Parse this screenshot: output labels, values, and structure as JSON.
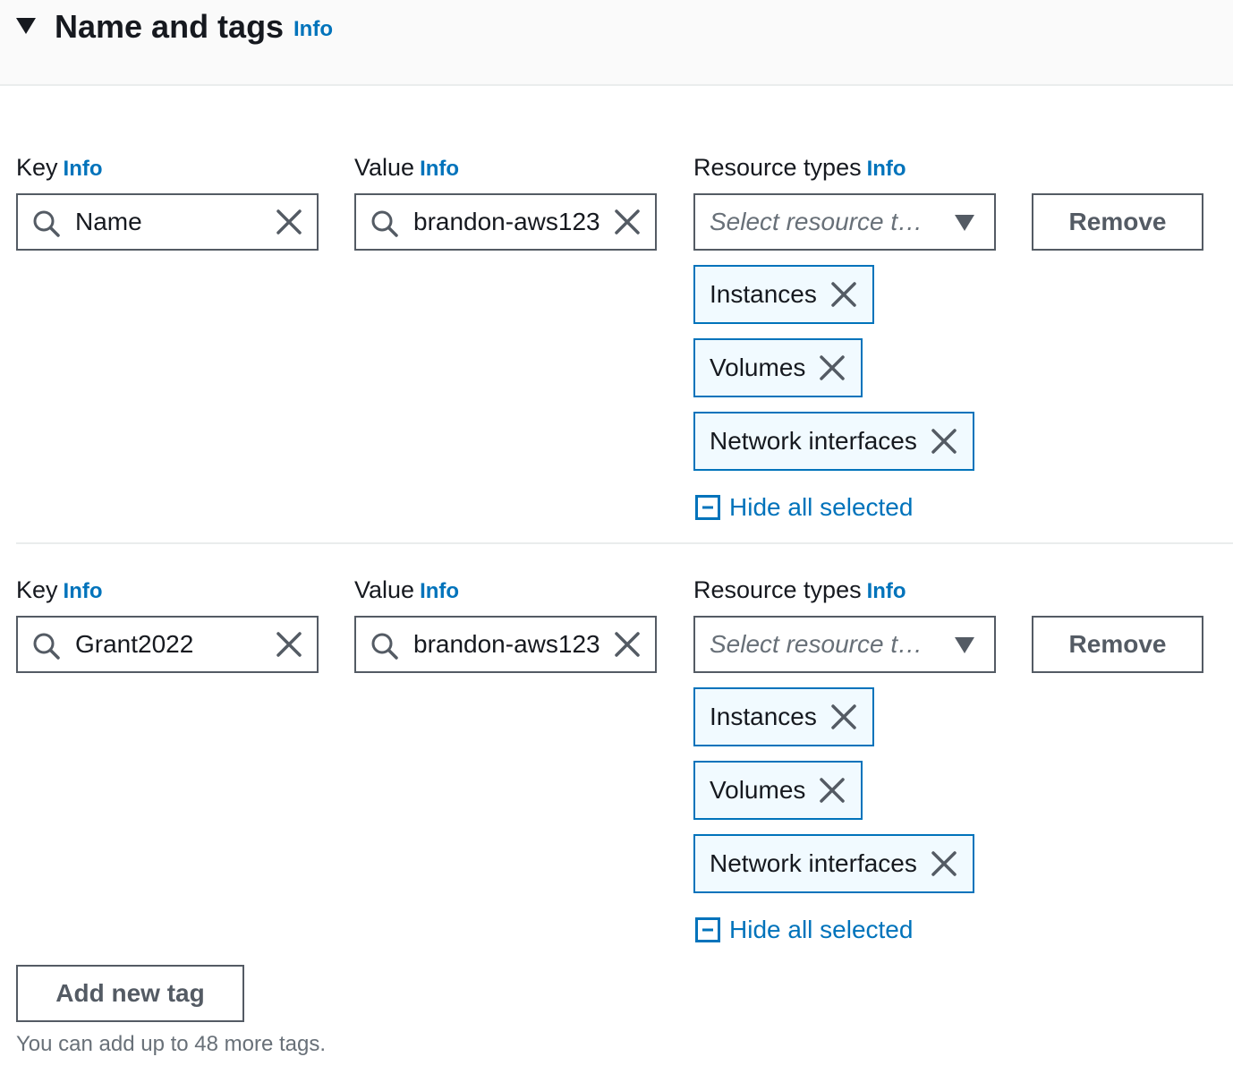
{
  "section": {
    "title": "Name and tags",
    "info_label": "Info"
  },
  "tags": [
    {
      "key_label": "Key",
      "key_info": "Info",
      "value_label": "Value",
      "value_info": "Info",
      "resource_label": "Resource types",
      "resource_info": "Info",
      "key_value": "Name",
      "value_value": "brandon-aws123",
      "resource_placeholder": "Select resource types",
      "remove_label": "Remove",
      "selected_resources": [
        "Instances",
        "Volumes",
        "Network interfaces"
      ],
      "hide_label": "Hide all selected"
    },
    {
      "key_label": "Key",
      "key_info": "Info",
      "value_label": "Value",
      "value_info": "Info",
      "resource_label": "Resource types",
      "resource_info": "Info",
      "key_value": "Grant2022",
      "value_value": "brandon-aws123",
      "resource_placeholder": "Select resource types",
      "remove_label": "Remove",
      "selected_resources": [
        "Instances",
        "Volumes",
        "Network interfaces"
      ],
      "hide_label": "Hide all selected"
    }
  ],
  "add_tag_label": "Add new tag",
  "tags_remaining_hint": "You can add up to 48 more tags.",
  "colors": {
    "link": "#0073bb",
    "border": "#545b64",
    "token_bg": "#f1faff",
    "text": "#16191f"
  },
  "icons": {
    "caret": "caret-down-icon",
    "search": "search-icon",
    "clear": "close-icon",
    "dropdown": "caret-down-icon",
    "token_dismiss": "close-icon",
    "hide": "minus-square-icon"
  }
}
